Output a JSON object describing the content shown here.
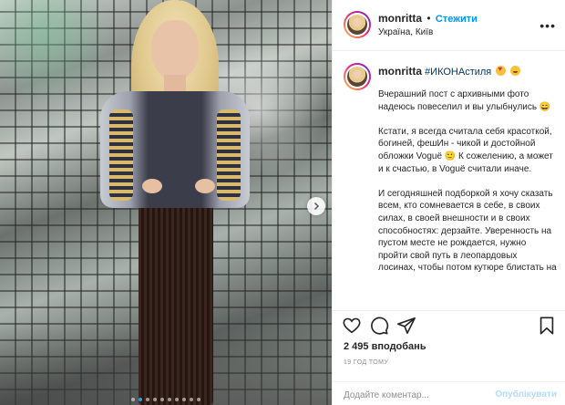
{
  "post": {
    "image_alt": "",
    "carousel": {
      "total": 10,
      "active_index": 1
    }
  },
  "header": {
    "username": "monritta",
    "separator": "•",
    "follow_label": "Стежити",
    "location": "Україна, Київ",
    "more_icon": "more-horizontal-icon"
  },
  "caption": {
    "username": "monritta",
    "hashtag": "#ИКОНАстиля",
    "emojis": [
      "heart-eyes-emoji",
      "grin-emoji"
    ],
    "paragraphs": [
      "Вчерашний пост с архивными фото надеюсь повеселил и вы улыбнулись 😄",
      "Кстати, я всегда считала себя красоткой, богиней, фешИн - чикой и достойной обложки Voguë 🙂 К сожелению, а может и к счастью, в Voguë считали иначе.",
      "И сегодняшней подборкой я хочу сказать всем, кто сомневается в себе, в своих силах, в своей внешности и в своих способностях: дерзайте. Уверенность на пустом месте не рождается, нужно пройти свой путь в леопардовых лосинах, чтобы потом кутюре блистать на"
    ]
  },
  "actions": {
    "icons": [
      "heart-icon",
      "comment-icon",
      "share-icon",
      "bookmark-icon"
    ]
  },
  "likes_text": "2 495 вподобань",
  "time_text": "19 год тому",
  "comment": {
    "placeholder": "Додайте коментар...",
    "post_label": "Опублікувати"
  },
  "colors": {
    "link_blue": "#0095f6",
    "hashtag_blue": "#00376b",
    "post_disabled": "#b3dbff",
    "muted": "#8e8e8e"
  }
}
